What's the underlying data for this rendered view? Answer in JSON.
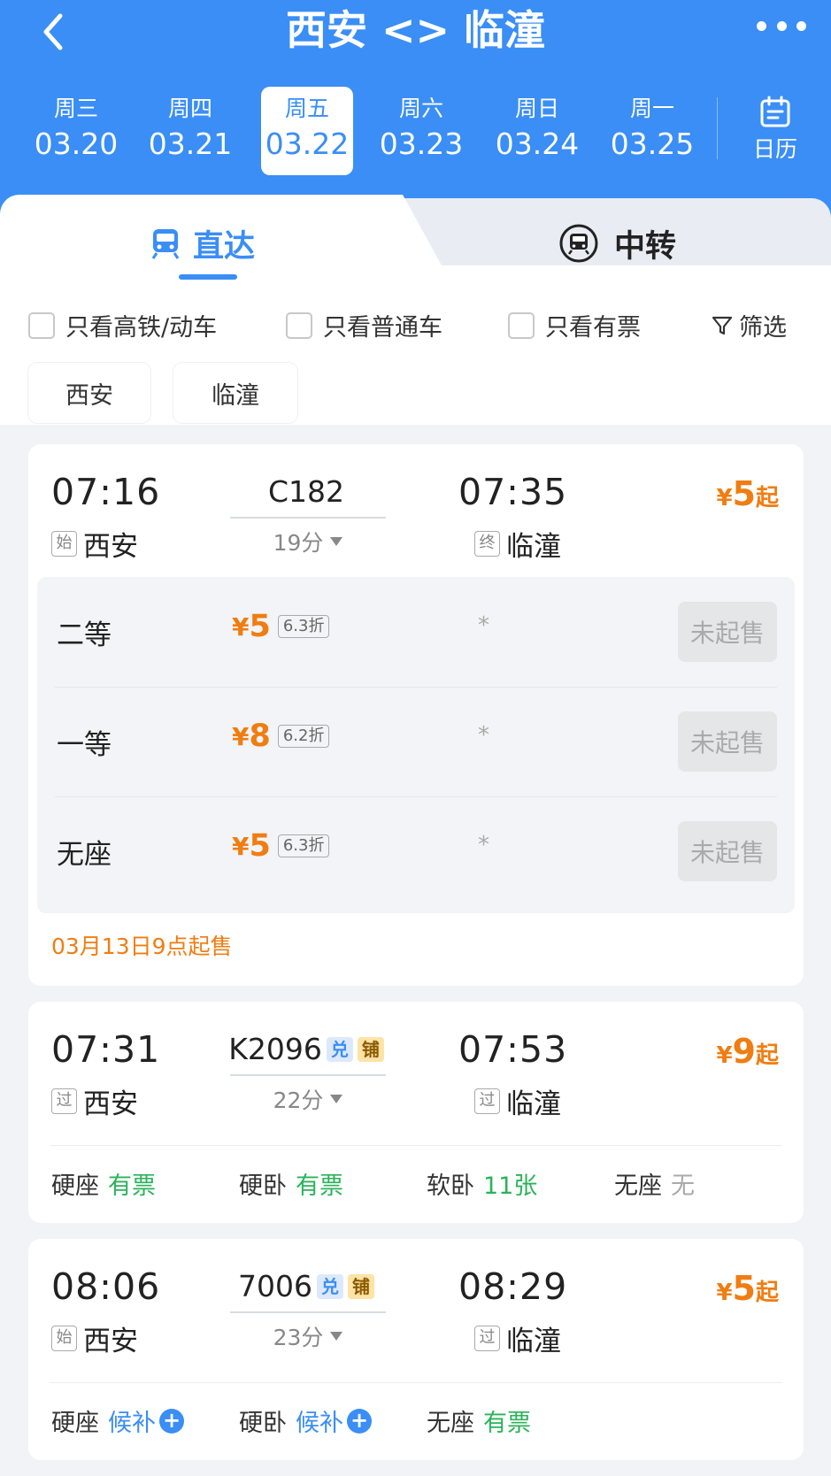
{
  "header": {
    "title": "西安 <> 临潼",
    "dates": [
      {
        "weekday": "周三",
        "date": "03.20"
      },
      {
        "weekday": "周四",
        "date": "03.21"
      },
      {
        "weekday": "周五",
        "date": "03.22"
      },
      {
        "weekday": "周六",
        "date": "03.23"
      },
      {
        "weekday": "周日",
        "date": "03.24"
      },
      {
        "weekday": "周一",
        "date": "03.25"
      }
    ],
    "calendar_label": "日历"
  },
  "tabs": {
    "direct": "直达",
    "transfer": "中转"
  },
  "filters": {
    "high_speed": "只看高铁/动车",
    "normal": "只看普通车",
    "has_ticket": "只看有票",
    "filter": "筛选"
  },
  "stations": [
    "西安",
    "临潼"
  ],
  "trains": [
    {
      "dep_time": "07:16",
      "dep_tag": "始",
      "dep_station": "西安",
      "number": "C182",
      "duration": "19分",
      "arr_time": "07:35",
      "arr_tag": "终",
      "arr_station": "临潼",
      "price_yen": "¥",
      "price": "5",
      "price_suffix": "起",
      "seats": [
        {
          "name": "二等",
          "yen": "¥",
          "price": "5",
          "discount": "6.3折",
          "star": "*",
          "status": "未起售"
        },
        {
          "name": "一等",
          "yen": "¥",
          "price": "8",
          "discount": "6.2折",
          "star": "*",
          "status": "未起售"
        },
        {
          "name": "无座",
          "yen": "¥",
          "price": "5",
          "discount": "6.3折",
          "star": "*",
          "status": "未起售"
        }
      ],
      "presale": "03月13日9点起售"
    },
    {
      "dep_time": "07:31",
      "dep_tag": "过",
      "dep_station": "西安",
      "number": "K2096",
      "badge1": "兑",
      "badge2": "铺",
      "duration": "22分",
      "arr_time": "07:53",
      "arr_tag": "过",
      "arr_station": "临潼",
      "price_yen": "¥",
      "price": "9",
      "price_suffix": "起",
      "availability": [
        {
          "name": "硬座",
          "value": "有票"
        },
        {
          "name": "硬卧",
          "value": "有票"
        },
        {
          "name": "软卧",
          "value": "11张"
        },
        {
          "name": "无座",
          "value": "无"
        }
      ]
    },
    {
      "dep_time": "08:06",
      "dep_tag": "始",
      "dep_station": "西安",
      "number": "7006",
      "badge1": "兑",
      "badge2": "铺",
      "duration": "23分",
      "arr_time": "08:29",
      "arr_tag": "过",
      "arr_station": "临潼",
      "price_yen": "¥",
      "price": "5",
      "price_suffix": "起",
      "availability": [
        {
          "name": "硬座",
          "value": "候补"
        },
        {
          "name": "硬卧",
          "value": "候补"
        },
        {
          "name": "无座",
          "value": "有票"
        }
      ]
    }
  ],
  "colors": {
    "accent": "#3a8ef6",
    "price": "#f07d12",
    "available": "#2bb35a"
  }
}
